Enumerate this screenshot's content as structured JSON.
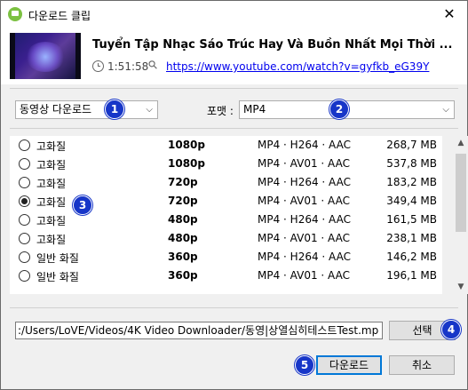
{
  "window": {
    "title": "다운로드 클립",
    "close_glyph": "✕"
  },
  "video": {
    "title": "Tuyển Tập Nhạc Sáo Trúc Hay Và Buồn Nhất Mọi Thời ...",
    "duration": "1:51:58",
    "url": "https://www.youtube.com/watch?v=gyfkb_eG39Y"
  },
  "controls": {
    "download_type": "동영상 다운로드",
    "format_label": "포맷 :",
    "format_value": "MP4"
  },
  "badges": [
    "1",
    "2",
    "3",
    "4",
    "5"
  ],
  "quality_options": [
    {
      "quality": "고화질",
      "resolution": "1080p",
      "codec": "MP4 · H264 · AAC",
      "size": "268,7 MB",
      "selected": false
    },
    {
      "quality": "고화질",
      "resolution": "1080p",
      "codec": "MP4 · AV01 · AAC",
      "size": "537,8 MB",
      "selected": false
    },
    {
      "quality": "고화질",
      "resolution": "720p",
      "codec": "MP4 · H264 · AAC",
      "size": "183,2 MB",
      "selected": false
    },
    {
      "quality": "고화질",
      "resolution": "720p",
      "codec": "MP4 · AV01 · AAC",
      "size": "349,4 MB",
      "selected": true
    },
    {
      "quality": "고화질",
      "resolution": "480p",
      "codec": "MP4 · H264 · AAC",
      "size": "161,5 MB",
      "selected": false
    },
    {
      "quality": "고화질",
      "resolution": "480p",
      "codec": "MP4 · AV01 · AAC",
      "size": "238,1 MB",
      "selected": false
    },
    {
      "quality": "일반 화질",
      "resolution": "360p",
      "codec": "MP4 · H264 · AAC",
      "size": "146,2 MB",
      "selected": false
    },
    {
      "quality": "일반 화질",
      "resolution": "360p",
      "codec": "MP4 · AV01 · AAC",
      "size": "196,1 MB",
      "selected": false
    }
  ],
  "save_path": ":/Users/LoVE/Videos/4K Video Downloader/동영|상열심히테스트Test.mp",
  "buttons": {
    "choose": "선택",
    "download": "다운로드",
    "cancel": "취소"
  },
  "icons": {
    "app": "app-icon",
    "close": "close-icon",
    "clock": "clock-icon",
    "link": "link-icon",
    "chevron": "chevron-down-icon"
  },
  "colors": {
    "badge": "#1736c8",
    "link": "#0000ee",
    "default_button_border": "#0078d7"
  }
}
